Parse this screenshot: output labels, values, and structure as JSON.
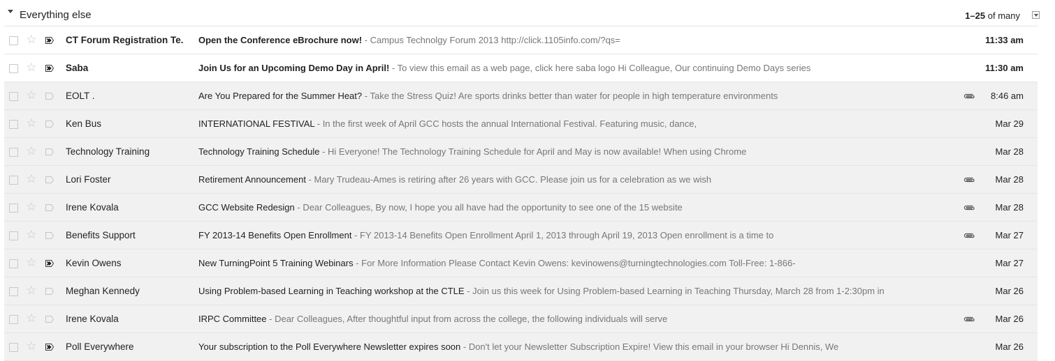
{
  "section": {
    "title": "Everything else",
    "pager_range": "1–25",
    "pager_of": "of",
    "pager_total": "many"
  },
  "icons": {
    "star": "star-icon",
    "important": "importance-marker-icon",
    "attachment": "paperclip-icon",
    "toggle": "triangle-down-icon"
  },
  "colors": {
    "read_row_bg": "#f1f1f1",
    "unread_row_bg": "#ffffff",
    "snippet": "#777777"
  },
  "rows": [
    {
      "sender": "CT Forum Registration Te.",
      "subject": "Open the Conference eBrochure now!",
      "snippet": " - Campus Technolgy Forum 2013 http://click.1105info.com/?qs=",
      "date": "11:33 am",
      "unread": true,
      "important": true,
      "attachment": false
    },
    {
      "sender": "Saba",
      "subject": "Join Us for an Upcoming Demo Day in April!",
      "snippet": " - To view this email as a web page, click here saba logo Hi Colleague, Our continuing Demo Days series",
      "date": "11:30 am",
      "unread": true,
      "important": true,
      "attachment": false
    },
    {
      "sender": "EOLT .",
      "subject": "Are You Prepared for the Summer Heat?",
      "snippet": " - Take the Stress Quiz! Are sports drinks better than water for people in high temperature environments",
      "date": "8:46 am",
      "unread": false,
      "important": false,
      "attachment": true
    },
    {
      "sender": "Ken Bus",
      "subject": "INTERNATIONAL FESTIVAL",
      "snippet": " - In the first week of April GCC hosts the annual International Festival. Featuring music, dance,",
      "date": "Mar 29",
      "unread": false,
      "important": false,
      "attachment": false
    },
    {
      "sender": "Technology Training",
      "subject": "Technology Training Schedule",
      "snippet": " - Hi Everyone! The Technology Training Schedule for April and May is now available! When using Chrome",
      "date": "Mar 28",
      "unread": false,
      "important": false,
      "attachment": false
    },
    {
      "sender": "Lori Foster",
      "subject": "Retirement Announcement",
      "snippet": " - Mary Trudeau-Ames is retiring after 26 years with GCC. Please join us for a celebration as we wish",
      "date": "Mar 28",
      "unread": false,
      "important": false,
      "attachment": true
    },
    {
      "sender": "Irene Kovala",
      "subject": "GCC Website Redesign",
      "snippet": " - Dear Colleagues, By now, I hope you all have had the opportunity to see one of the 15 website",
      "date": "Mar 28",
      "unread": false,
      "important": false,
      "attachment": true
    },
    {
      "sender": "Benefits Support",
      "subject": "FY 2013-14 Benefits Open Enrollment",
      "snippet": " - FY 2013-14 Benefits Open Enrollment April 1, 2013 through April 19, 2013 Open enrollment is a time to",
      "date": "Mar 27",
      "unread": false,
      "important": false,
      "attachment": true
    },
    {
      "sender": "Kevin Owens",
      "subject": "New TurningPoint 5 Training Webinars",
      "snippet": " - For More Information Please Contact Kevin Owens: kevinowens@turningtechnologies.com Toll-Free: 1-866-",
      "date": "Mar 27",
      "unread": false,
      "important": true,
      "attachment": false
    },
    {
      "sender": "Meghan Kennedy",
      "subject": "Using Problem-based Learning in Teaching workshop at the CTLE",
      "snippet": " - Join us this week for Using Problem-based Learning in Teaching Thursday, March 28 from 1-2:30pm in",
      "date": "Mar 26",
      "unread": false,
      "important": false,
      "attachment": false
    },
    {
      "sender": "Irene Kovala",
      "subject": "IRPC Committee",
      "snippet": " - Dear Colleagues, After thoughtful input from across the college, the following individuals will serve",
      "date": "Mar 26",
      "unread": false,
      "important": false,
      "attachment": true
    },
    {
      "sender": "Poll Everywhere",
      "subject": "Your subscription to the Poll Everywhere Newsletter expires soon",
      "snippet": " - Don't let your Newsletter Subscription Expire! View this email in your browser Hi Dennis, We",
      "date": "Mar 26",
      "unread": false,
      "important": true,
      "attachment": false
    }
  ]
}
